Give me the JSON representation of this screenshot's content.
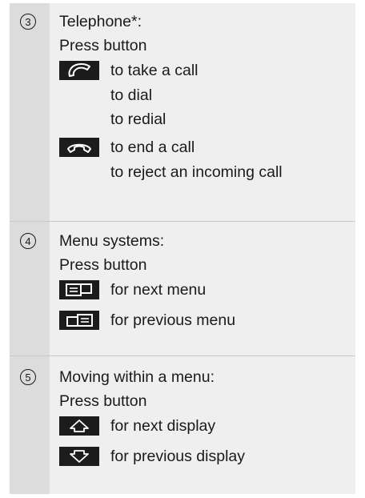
{
  "sections": [
    {
      "number": "3",
      "title": "Telephone*:",
      "instruction": "Press button",
      "items": [
        {
          "icon": "phone-pickup-icon",
          "lines": [
            "to take a call",
            "to dial",
            "to redial"
          ]
        },
        {
          "icon": "phone-hangup-icon",
          "lines": [
            "to end a call",
            "to reject an incoming call"
          ]
        }
      ]
    },
    {
      "number": "4",
      "title": "Menu systems:",
      "instruction": "Press button",
      "items": [
        {
          "icon": "next-menu-icon",
          "lines": [
            "for next menu"
          ]
        },
        {
          "icon": "previous-menu-icon",
          "lines": [
            "for previous menu"
          ]
        }
      ]
    },
    {
      "number": "5",
      "title": "Moving within a menu:",
      "instruction": "Press button",
      "items": [
        {
          "icon": "arrow-up-icon",
          "lines": [
            "for next display"
          ]
        },
        {
          "icon": "arrow-down-icon",
          "lines": [
            "for previous display"
          ]
        }
      ]
    }
  ]
}
